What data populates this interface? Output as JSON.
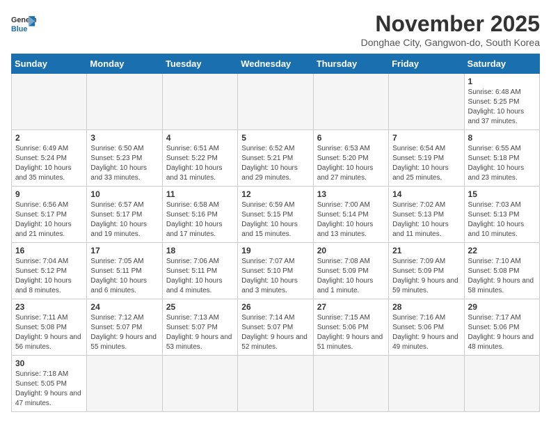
{
  "header": {
    "logo_general": "General",
    "logo_blue": "Blue",
    "month_title": "November 2025",
    "subtitle": "Donghae City, Gangwon-do, South Korea"
  },
  "weekdays": [
    "Sunday",
    "Monday",
    "Tuesday",
    "Wednesday",
    "Thursday",
    "Friday",
    "Saturday"
  ],
  "weeks": [
    [
      {
        "day": "",
        "info": ""
      },
      {
        "day": "",
        "info": ""
      },
      {
        "day": "",
        "info": ""
      },
      {
        "day": "",
        "info": ""
      },
      {
        "day": "",
        "info": ""
      },
      {
        "day": "",
        "info": ""
      },
      {
        "day": "1",
        "info": "Sunrise: 6:48 AM\nSunset: 5:25 PM\nDaylight: 10 hours and 37 minutes."
      }
    ],
    [
      {
        "day": "2",
        "info": "Sunrise: 6:49 AM\nSunset: 5:24 PM\nDaylight: 10 hours and 35 minutes."
      },
      {
        "day": "3",
        "info": "Sunrise: 6:50 AM\nSunset: 5:23 PM\nDaylight: 10 hours and 33 minutes."
      },
      {
        "day": "4",
        "info": "Sunrise: 6:51 AM\nSunset: 5:22 PM\nDaylight: 10 hours and 31 minutes."
      },
      {
        "day": "5",
        "info": "Sunrise: 6:52 AM\nSunset: 5:21 PM\nDaylight: 10 hours and 29 minutes."
      },
      {
        "day": "6",
        "info": "Sunrise: 6:53 AM\nSunset: 5:20 PM\nDaylight: 10 hours and 27 minutes."
      },
      {
        "day": "7",
        "info": "Sunrise: 6:54 AM\nSunset: 5:19 PM\nDaylight: 10 hours and 25 minutes."
      },
      {
        "day": "8",
        "info": "Sunrise: 6:55 AM\nSunset: 5:18 PM\nDaylight: 10 hours and 23 minutes."
      }
    ],
    [
      {
        "day": "9",
        "info": "Sunrise: 6:56 AM\nSunset: 5:17 PM\nDaylight: 10 hours and 21 minutes."
      },
      {
        "day": "10",
        "info": "Sunrise: 6:57 AM\nSunset: 5:17 PM\nDaylight: 10 hours and 19 minutes."
      },
      {
        "day": "11",
        "info": "Sunrise: 6:58 AM\nSunset: 5:16 PM\nDaylight: 10 hours and 17 minutes."
      },
      {
        "day": "12",
        "info": "Sunrise: 6:59 AM\nSunset: 5:15 PM\nDaylight: 10 hours and 15 minutes."
      },
      {
        "day": "13",
        "info": "Sunrise: 7:00 AM\nSunset: 5:14 PM\nDaylight: 10 hours and 13 minutes."
      },
      {
        "day": "14",
        "info": "Sunrise: 7:02 AM\nSunset: 5:13 PM\nDaylight: 10 hours and 11 minutes."
      },
      {
        "day": "15",
        "info": "Sunrise: 7:03 AM\nSunset: 5:13 PM\nDaylight: 10 hours and 10 minutes."
      }
    ],
    [
      {
        "day": "16",
        "info": "Sunrise: 7:04 AM\nSunset: 5:12 PM\nDaylight: 10 hours and 8 minutes."
      },
      {
        "day": "17",
        "info": "Sunrise: 7:05 AM\nSunset: 5:11 PM\nDaylight: 10 hours and 6 minutes."
      },
      {
        "day": "18",
        "info": "Sunrise: 7:06 AM\nSunset: 5:11 PM\nDaylight: 10 hours and 4 minutes."
      },
      {
        "day": "19",
        "info": "Sunrise: 7:07 AM\nSunset: 5:10 PM\nDaylight: 10 hours and 3 minutes."
      },
      {
        "day": "20",
        "info": "Sunrise: 7:08 AM\nSunset: 5:09 PM\nDaylight: 10 hours and 1 minute."
      },
      {
        "day": "21",
        "info": "Sunrise: 7:09 AM\nSunset: 5:09 PM\nDaylight: 9 hours and 59 minutes."
      },
      {
        "day": "22",
        "info": "Sunrise: 7:10 AM\nSunset: 5:08 PM\nDaylight: 9 hours and 58 minutes."
      }
    ],
    [
      {
        "day": "23",
        "info": "Sunrise: 7:11 AM\nSunset: 5:08 PM\nDaylight: 9 hours and 56 minutes."
      },
      {
        "day": "24",
        "info": "Sunrise: 7:12 AM\nSunset: 5:07 PM\nDaylight: 9 hours and 55 minutes."
      },
      {
        "day": "25",
        "info": "Sunrise: 7:13 AM\nSunset: 5:07 PM\nDaylight: 9 hours and 53 minutes."
      },
      {
        "day": "26",
        "info": "Sunrise: 7:14 AM\nSunset: 5:07 PM\nDaylight: 9 hours and 52 minutes."
      },
      {
        "day": "27",
        "info": "Sunrise: 7:15 AM\nSunset: 5:06 PM\nDaylight: 9 hours and 51 minutes."
      },
      {
        "day": "28",
        "info": "Sunrise: 7:16 AM\nSunset: 5:06 PM\nDaylight: 9 hours and 49 minutes."
      },
      {
        "day": "29",
        "info": "Sunrise: 7:17 AM\nSunset: 5:06 PM\nDaylight: 9 hours and 48 minutes."
      }
    ],
    [
      {
        "day": "30",
        "info": "Sunrise: 7:18 AM\nSunset: 5:05 PM\nDaylight: 9 hours and 47 minutes."
      },
      {
        "day": "",
        "info": ""
      },
      {
        "day": "",
        "info": ""
      },
      {
        "day": "",
        "info": ""
      },
      {
        "day": "",
        "info": ""
      },
      {
        "day": "",
        "info": ""
      },
      {
        "day": "",
        "info": ""
      }
    ]
  ]
}
